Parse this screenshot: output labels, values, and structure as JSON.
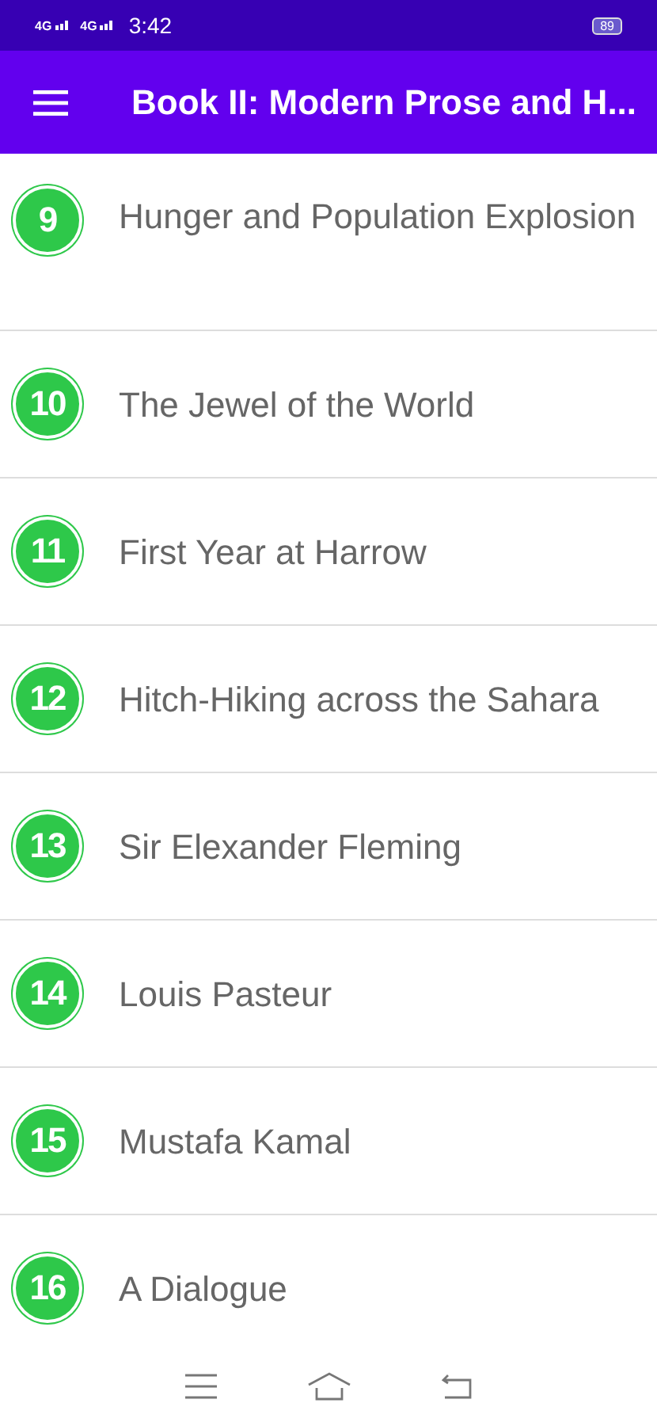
{
  "status_bar": {
    "network_1": "4G",
    "network_2": "4G",
    "time": "3:42",
    "battery": "89"
  },
  "app_bar": {
    "title": "Book II: Modern Prose and H..."
  },
  "chapters": [
    {
      "number": "9",
      "title": "Hunger and Population Explosion"
    },
    {
      "number": "10",
      "title": "The Jewel of the World"
    },
    {
      "number": "11",
      "title": "First Year at Harrow"
    },
    {
      "number": "12",
      "title": "Hitch-Hiking across the Sahara"
    },
    {
      "number": "13",
      "title": "Sir Elexander Fleming"
    },
    {
      "number": "14",
      "title": "Louis Pasteur"
    },
    {
      "number": "15",
      "title": "Mustafa Kamal"
    },
    {
      "number": "16",
      "title": "A Dialogue"
    }
  ]
}
